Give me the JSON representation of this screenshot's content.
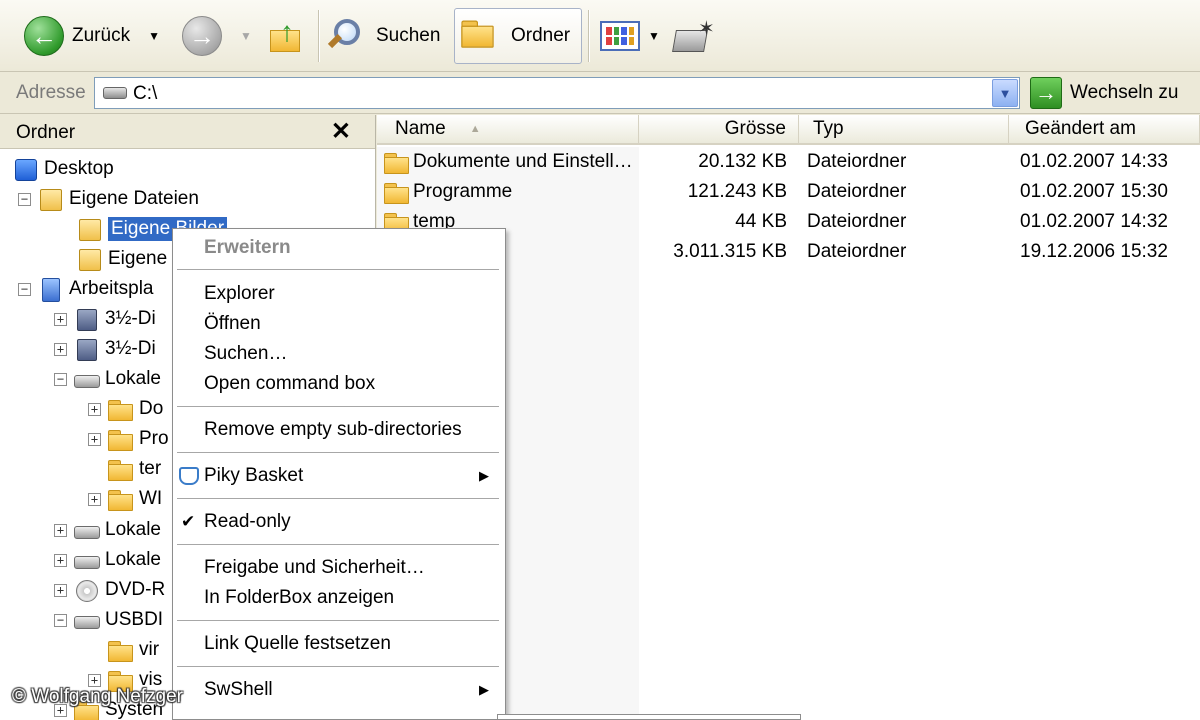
{
  "toolbar": {
    "back_label": "Zurück",
    "search_label": "Suchen",
    "folders_label": "Ordner"
  },
  "address": {
    "label": "Adresse",
    "value": "C:\\",
    "go_label": "Wechseln zu"
  },
  "folder_pane": {
    "title": "Ordner",
    "close_glyph": "✕",
    "tree": [
      {
        "label": "Desktop",
        "icon": "desktop-icon"
      },
      {
        "label": "Eigene Dateien",
        "icon": "documents-icon",
        "expander": "−"
      },
      {
        "label": "Eigene Bilder",
        "icon": "pictures-icon"
      },
      {
        "label": "Eigene",
        "icon": "music-icon"
      },
      {
        "label": "Arbeitspla",
        "icon": "computer-icon",
        "expander": "−"
      },
      {
        "label": "3½-Di",
        "icon": "floppy-icon",
        "expander": "+"
      },
      {
        "label": "3½-Di",
        "icon": "floppy-icon",
        "expander": "+"
      },
      {
        "label": "Lokale",
        "icon": "drive-icon",
        "expander": "−"
      },
      {
        "label": "Do",
        "icon": "folder-icon",
        "expander": "+"
      },
      {
        "label": "Pro",
        "icon": "folder-icon",
        "expander": "+"
      },
      {
        "label": "ter",
        "icon": "folder-icon"
      },
      {
        "label": "WI",
        "icon": "folder-icon",
        "expander": "+"
      },
      {
        "label": "Lokale",
        "icon": "drive-icon",
        "expander": "+"
      },
      {
        "label": "Lokale",
        "icon": "drive-icon",
        "expander": "+"
      },
      {
        "label": "DVD-R",
        "icon": "dvd-icon",
        "expander": "+"
      },
      {
        "label": "USBDI",
        "icon": "drive-icon",
        "expander": "−"
      },
      {
        "label": "vir",
        "icon": "folder-icon"
      },
      {
        "label": "vis",
        "icon": "folder-icon",
        "expander": "+"
      },
      {
        "label": "Systen",
        "icon": "folder-icon",
        "expander": "+"
      }
    ]
  },
  "list": {
    "columns": {
      "name": "Name",
      "size": "Grösse",
      "type": "Typ",
      "modified": "Geändert am"
    },
    "rows": [
      {
        "name": "Dokumente und Einstell…",
        "size": "20.132 KB",
        "type": "Dateiordner",
        "modified": "01.02.2007 14:33"
      },
      {
        "name": "Programme",
        "size": "121.243 KB",
        "type": "Dateiordner",
        "modified": "01.02.2007 15:30"
      },
      {
        "name": "temp",
        "size": "44 KB",
        "type": "Dateiordner",
        "modified": "01.02.2007 14:32"
      },
      {
        "name": "",
        "size": "3.011.315 KB",
        "type": "Dateiordner",
        "modified": "19.12.2006 15:32"
      }
    ]
  },
  "context_menu": {
    "header": "Erweitern",
    "items": [
      "Explorer",
      "Öffnen",
      "Suchen…",
      "Open command box",
      "Remove empty sub-directories",
      "Piky Basket",
      "Read-only",
      "Freigabe und Sicherheit…",
      "In FolderBox anzeigen",
      "Link Quelle festsetzen",
      "SwShell"
    ],
    "check_glyph": "✔",
    "submenu_glyph": "▶"
  },
  "watermark": "© Wolfgang Nefzger"
}
